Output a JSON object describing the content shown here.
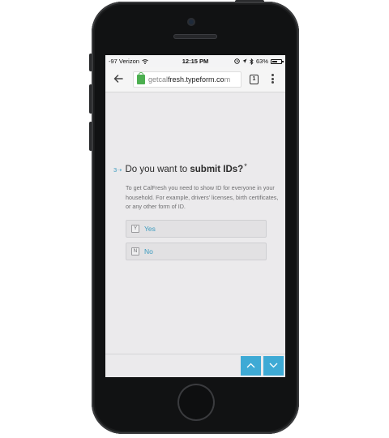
{
  "status_bar": {
    "carrier": "-97 Verizon",
    "time": "12:15 PM",
    "battery": "63%",
    "battery_level": 0.63
  },
  "browser": {
    "url_prefix": "getcal",
    "url_domain": "fresh.typeform.co",
    "url_suffix": "m",
    "tab_count": "1"
  },
  "question": {
    "number": "3",
    "title_plain": "Do you want to ",
    "title_bold": "submit IDs?",
    "required_mark": "*",
    "description": "To get CalFresh you need to show ID for everyone in your household. For example,  drivers' licenses, birth certificates, or any other form of ID."
  },
  "choices": [
    {
      "key": "Y",
      "label": "Yes"
    },
    {
      "key": "N",
      "label": "No"
    }
  ],
  "colors": {
    "accent": "#3eaad5",
    "background": "#ebeaec"
  }
}
